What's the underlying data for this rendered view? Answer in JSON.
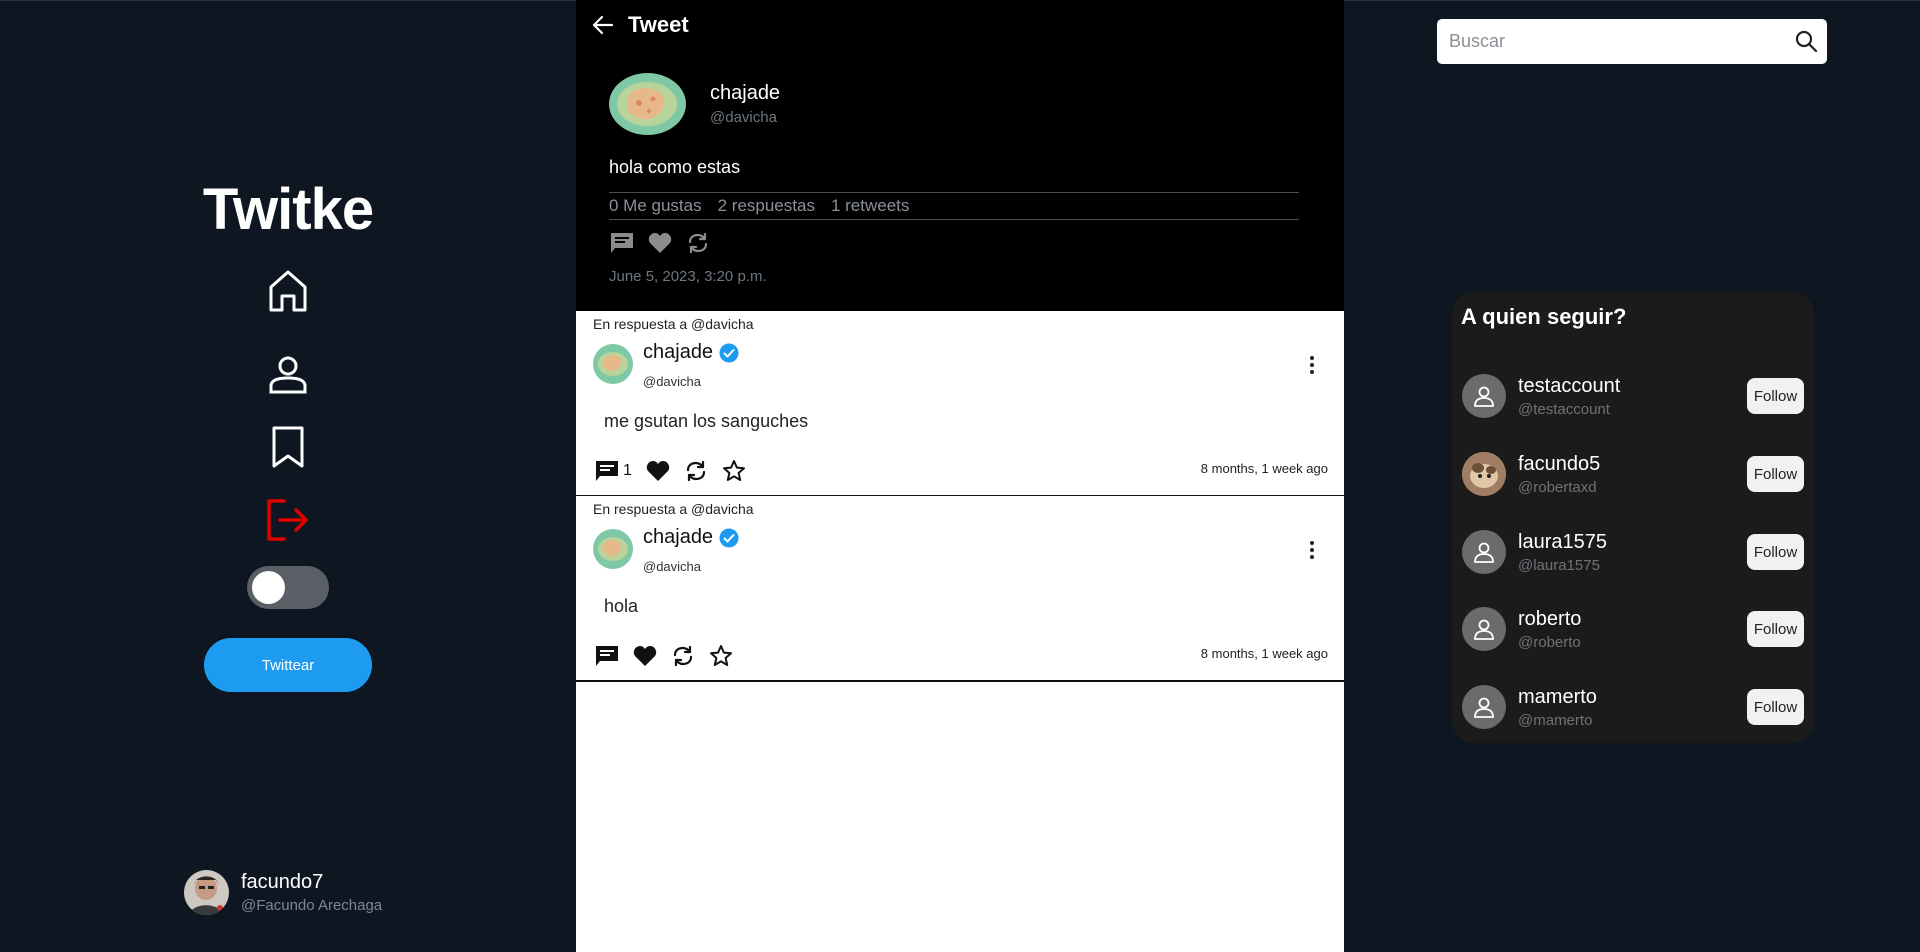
{
  "sidebar": {
    "brand": "Twitke",
    "tweet_button": "Twittear",
    "current_user": {
      "name": "facundo7",
      "handle": "@Facundo Arechaga"
    },
    "icons": [
      "home-icon",
      "profile-icon",
      "bookmark-icon",
      "logout-icon"
    ],
    "logout_color": "#e10000"
  },
  "main_tweet": {
    "header_title": "Tweet",
    "author": {
      "name": "chajade",
      "handle": "@davicha"
    },
    "text": "hola como estas",
    "stats": {
      "likes": "0 Me gustas",
      "replies": "2 respuestas",
      "retweets": "1 retweets"
    },
    "date": "June 5, 2023, 3:20 p.m."
  },
  "replies": [
    {
      "context": "En respuesta a @davicha",
      "name": "chajade",
      "handle": "@davicha",
      "text": "me gsutan los sanguches",
      "comment_count": "1",
      "time": "8 months, 1 week ago"
    },
    {
      "context": "En respuesta a @davicha",
      "name": "chajade",
      "handle": "@davicha",
      "text": "hola",
      "comment_count": "",
      "time": "8 months, 1 week ago"
    }
  ],
  "search": {
    "placeholder": "Buscar"
  },
  "who_to_follow": {
    "title": "A quien seguir?",
    "follow_label": "Follow",
    "users": [
      {
        "name": "testaccount",
        "handle": "@testaccount"
      },
      {
        "name": "facundo5",
        "handle": "@robertaxd"
      },
      {
        "name": "laura1575",
        "handle": "@laura1575"
      },
      {
        "name": "roberto",
        "handle": "@roberto"
      },
      {
        "name": "mamerto",
        "handle": "@mamerto"
      }
    ]
  },
  "colors": {
    "background": "#0e1621",
    "accent": "#1d9bf0",
    "verified": "#1d9bf0"
  }
}
